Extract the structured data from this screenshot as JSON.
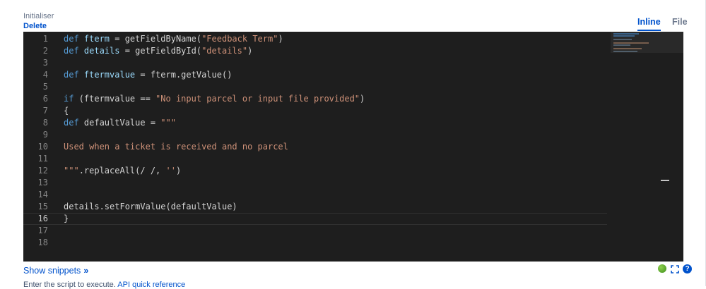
{
  "header": {
    "section_label": "Initialiser",
    "delete_link": "Delete"
  },
  "tabs": [
    {
      "label": "Inline",
      "active": true
    },
    {
      "label": "File",
      "active": false
    }
  ],
  "editor": {
    "current_line": 16,
    "lines": [
      {
        "n": "1",
        "tokens": [
          {
            "t": "k",
            "v": "def "
          },
          {
            "t": "v",
            "v": "fterm"
          },
          {
            "t": "p",
            "v": " = getFieldByName("
          },
          {
            "t": "s",
            "v": "\"Feedback Term\""
          },
          {
            "t": "p",
            "v": ")"
          }
        ]
      },
      {
        "n": "2",
        "tokens": [
          {
            "t": "k",
            "v": "def "
          },
          {
            "t": "v",
            "v": "details"
          },
          {
            "t": "p",
            "v": " = getFieldById("
          },
          {
            "t": "s",
            "v": "\"details\""
          },
          {
            "t": "p",
            "v": ")"
          }
        ]
      },
      {
        "n": "3",
        "tokens": []
      },
      {
        "n": "4",
        "tokens": [
          {
            "t": "k",
            "v": "def "
          },
          {
            "t": "v",
            "v": "ftermvalue"
          },
          {
            "t": "p",
            "v": " = fterm.getValue()"
          }
        ]
      },
      {
        "n": "5",
        "tokens": []
      },
      {
        "n": "6",
        "tokens": [
          {
            "t": "k",
            "v": "if"
          },
          {
            "t": "p",
            "v": " (ftermvalue == "
          },
          {
            "t": "s",
            "v": "\"No input parcel or input file provided\""
          },
          {
            "t": "p",
            "v": ")"
          }
        ]
      },
      {
        "n": "7",
        "tokens": [
          {
            "t": "p",
            "v": "{"
          }
        ]
      },
      {
        "n": "8",
        "tokens": [
          {
            "t": "k",
            "v": "def"
          },
          {
            "t": "p",
            "v": " defaultValue = "
          },
          {
            "t": "s",
            "v": "\"\"\""
          }
        ]
      },
      {
        "n": "9",
        "tokens": []
      },
      {
        "n": "10",
        "tokens": [
          {
            "t": "s",
            "v": "Used when a ticket is received and no parcel"
          }
        ]
      },
      {
        "n": "11",
        "tokens": []
      },
      {
        "n": "12",
        "tokens": [
          {
            "t": "s",
            "v": "\"\"\""
          },
          {
            "t": "p",
            "v": ".replaceAll(/ /, "
          },
          {
            "t": "s",
            "v": "''"
          },
          {
            "t": "p",
            "v": ")"
          }
        ]
      },
      {
        "n": "13",
        "tokens": []
      },
      {
        "n": "14",
        "tokens": []
      },
      {
        "n": "15",
        "tokens": [
          {
            "t": "p",
            "v": "details.setFormValue(defaultValue)"
          }
        ]
      },
      {
        "n": "16",
        "tokens": [
          {
            "t": "p",
            "v": "}"
          }
        ]
      },
      {
        "n": "17",
        "tokens": []
      },
      {
        "n": "18",
        "tokens": []
      }
    ]
  },
  "footer": {
    "show_snippets": "Show snippets",
    "chevron": "»",
    "status": "valid",
    "help_icon": "?",
    "help_text_prefix": "Enter the script to execute. ",
    "help_link": "API quick reference"
  },
  "colors": {
    "accent": "#0052cc",
    "editor_bg": "#1e1e1e",
    "keyword": "#569cd6",
    "variable": "#9cdcfe",
    "string": "#ce9178",
    "status_ok": "#5cb82e"
  }
}
